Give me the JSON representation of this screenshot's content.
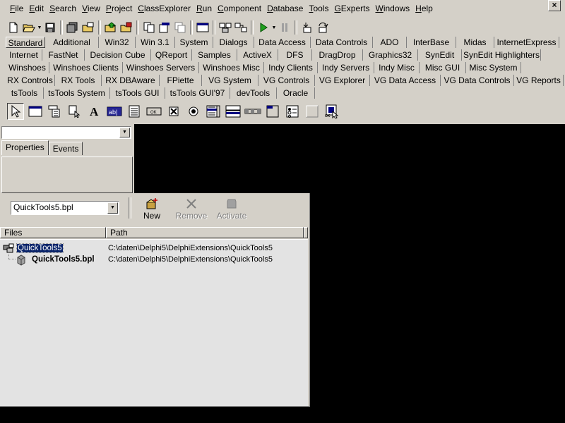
{
  "menu": [
    "File",
    "Edit",
    "Search",
    "View",
    "Project",
    "ClassExplorer",
    "Run",
    "Component",
    "Database",
    "Tools",
    "GExperts",
    "Windows",
    "Help"
  ],
  "window_controls": {
    "close": "×"
  },
  "toolbar_icons": [
    "new-icon",
    "open-icon",
    "save-icon",
    "save-all-icon",
    "open-project-icon",
    "add-file-icon",
    "remove-file-icon",
    "toggle-form-unit-icon",
    "view-unit-icon",
    "view-form-icon",
    "new-form-icon",
    "run-icon",
    "pause-icon",
    "trace-into-icon",
    "step-over-icon"
  ],
  "palette_tabs": [
    [
      {
        "label": "Standard",
        "active": true
      },
      {
        "label": "Additional"
      },
      {
        "label": "Win32"
      },
      {
        "label": "Win 3.1"
      },
      {
        "label": "System"
      },
      {
        "label": "Dialogs"
      },
      {
        "label": "Data Access"
      },
      {
        "label": "Data Controls"
      },
      {
        "label": "ADO"
      },
      {
        "label": "InterBase"
      },
      {
        "label": "Midas"
      },
      {
        "label": "InternetExpress"
      }
    ],
    [
      {
        "label": "Internet"
      },
      {
        "label": "FastNet"
      },
      {
        "label": "Decision Cube"
      },
      {
        "label": "QReport"
      },
      {
        "label": "Samples"
      },
      {
        "label": "ActiveX"
      },
      {
        "label": "DFS"
      },
      {
        "label": "DragDrop"
      },
      {
        "label": "Graphics32"
      },
      {
        "label": "SynEdit"
      },
      {
        "label": "SynEdit Highlighters"
      }
    ],
    [
      {
        "label": "Winshoes"
      },
      {
        "label": "Winshoes Clients"
      },
      {
        "label": "Winshoes Servers"
      },
      {
        "label": "Winshoes Misc"
      },
      {
        "label": "Indy Clients"
      },
      {
        "label": "Indy Servers"
      },
      {
        "label": "Indy Misc"
      },
      {
        "label": "Misc GUI"
      },
      {
        "label": "Misc System"
      }
    ],
    [
      {
        "label": "RX Controls"
      },
      {
        "label": "RX Tools"
      },
      {
        "label": "RX DBAware"
      },
      {
        "label": "FPiette"
      },
      {
        "label": "VG System"
      },
      {
        "label": "VG Controls"
      },
      {
        "label": "VG Explorer"
      },
      {
        "label": "VG Data Access"
      },
      {
        "label": "VG Data Controls"
      },
      {
        "label": "VG Reports"
      }
    ],
    [
      {
        "label": "tsTools"
      },
      {
        "label": "tsTools System"
      },
      {
        "label": "tsTools GUI"
      },
      {
        "label": "tsTools GUI'97"
      },
      {
        "label": "devTools"
      },
      {
        "label": "Oracle"
      }
    ]
  ],
  "palette_components": [
    "pointer-icon",
    "frame-icon",
    "main-menu-icon",
    "popup-menu-icon",
    "label-icon",
    "edit-icon",
    "memo-icon",
    "button-icon",
    "checkbox-icon",
    "radio-button-icon",
    "listbox-icon",
    "combobox-icon",
    "scrollbar-icon",
    "groupbox-icon",
    "radiogroup-icon",
    "panel-icon",
    "actionlist-icon"
  ],
  "inspector": {
    "object_select": "",
    "tabs": [
      {
        "label": "Properties",
        "active": true
      },
      {
        "label": "Events"
      }
    ]
  },
  "packages": {
    "selected_package": "QuickTools5.bpl",
    "buttons": [
      {
        "label": "New",
        "enabled": true
      },
      {
        "label": "Remove",
        "enabled": false
      },
      {
        "label": "Activate",
        "enabled": false
      }
    ],
    "columns": [
      "Files",
      "Path"
    ],
    "rows": [
      {
        "name": "QuickTools5",
        "path": "C:\\daten\\Delphi5\\DelphiExtensions\\QuickTools5",
        "level": 0,
        "selected": true
      },
      {
        "name": "QuickTools5.bpl",
        "path": "C:\\daten\\Delphi5\\DelphiExtensions\\QuickTools5",
        "level": 1,
        "selected": false
      }
    ]
  },
  "colors": {
    "face": "#d4d0c8",
    "desktop": "#000000",
    "selection": "#0a246a",
    "list_bg": "#e3e3e3"
  }
}
